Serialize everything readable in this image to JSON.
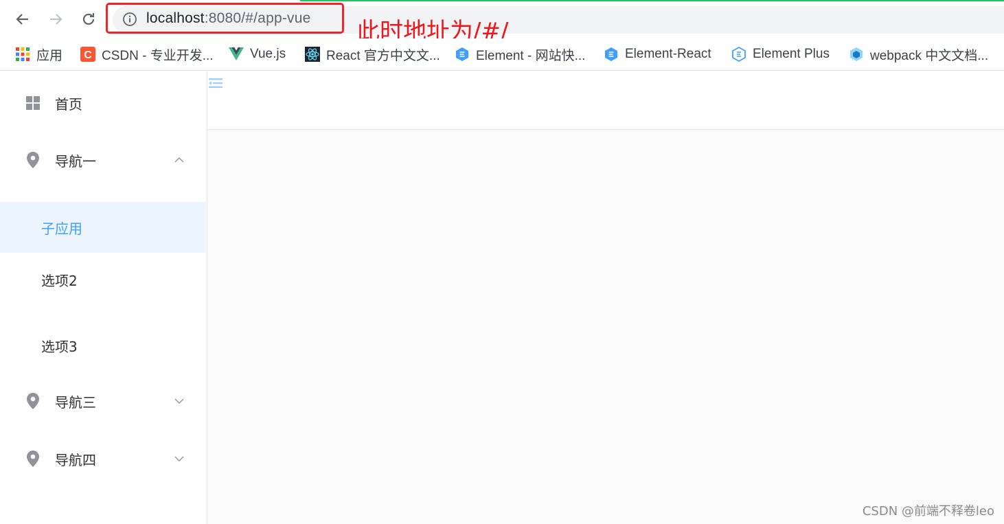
{
  "browser": {
    "url_host": "localhost",
    "url_path": ":8080/#/app-vue",
    "annotation": "此时地址为/#/",
    "bookmarks": [
      {
        "label": "应用",
        "icon": "apps-grid-icon"
      },
      {
        "label": "CSDN - 专业开发...",
        "icon": "csdn-icon"
      },
      {
        "label": "Vue.js",
        "icon": "vue-icon"
      },
      {
        "label": "React 官方中文文...",
        "icon": "react-icon"
      },
      {
        "label": "Element - 网站快...",
        "icon": "element-icon"
      },
      {
        "label": "Element-React",
        "icon": "element-icon"
      },
      {
        "label": "Element Plus",
        "icon": "element-plus-icon"
      },
      {
        "label": "webpack 中文文档...",
        "icon": "webpack-icon"
      }
    ]
  },
  "sidebar": {
    "home": {
      "label": "首页",
      "icon": "grid-icon"
    },
    "nav1": {
      "label": "导航一",
      "icon": "location-icon",
      "expanded": true
    },
    "nav1_items": [
      {
        "label": "子应用",
        "active": true
      },
      {
        "label": "选项2",
        "active": false
      },
      {
        "label": "选项3",
        "active": false
      }
    ],
    "nav3": {
      "label": "导航三",
      "icon": "location-icon",
      "expanded": false
    },
    "nav4": {
      "label": "导航四",
      "icon": "location-icon",
      "expanded": false
    }
  },
  "colors": {
    "accent": "#409eff",
    "active_bg": "#ecf5ff",
    "highlight_red": "#e8282b"
  },
  "watermark": "CSDN @前端不释卷leo"
}
